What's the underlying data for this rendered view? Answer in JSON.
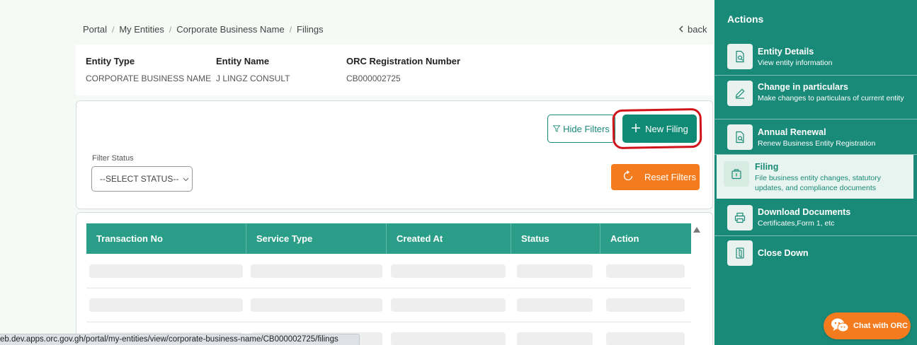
{
  "breadcrumb": [
    "Portal",
    "My Entities",
    "Corporate Business Name",
    "Filings"
  ],
  "breadcrumb_sep": "/",
  "back_label": "back",
  "entity": {
    "type_label": "Entity Type",
    "type_value": "CORPORATE BUSINESS NAME",
    "name_label": "Entity Name",
    "name_value": "J LINGZ CONSULT",
    "reg_label": "ORC Registration Number",
    "reg_value": "CB000002725"
  },
  "filters": {
    "hide_label": "Hide Filters",
    "new_label": "New Filing",
    "status_label": "Filter Status",
    "status_placeholder": "--SELECT STATUS--",
    "reset_label": "Reset Filters"
  },
  "table": {
    "columns": [
      "Transaction No",
      "Service Type",
      "Created At",
      "Status",
      "Action"
    ],
    "loading_rows": 3
  },
  "status_url": "eb.dev.apps.orc.gov.gh/portal/my-entities/view/corporate-business-name/CB000002725/filings",
  "sidebar": {
    "title": "Actions",
    "items": [
      {
        "label": "Entity Details",
        "desc": "View entity information",
        "icon": "file-search-icon"
      },
      {
        "label": "Change in particulars",
        "desc": "Make changes to particulars of current entity",
        "icon": "pencil-icon"
      },
      {
        "label": "Annual Renewal",
        "desc": "Renew Business Entity Registration",
        "icon": "file-search-icon"
      },
      {
        "label": "Filing",
        "desc": "File business entity changes, statutory updates, and compliance documents",
        "icon": "folder-icon",
        "active": true
      },
      {
        "label": "Download Documents",
        "desc": "Certificates,Form 1, etc",
        "icon": "printer-icon"
      },
      {
        "label": "Close Down",
        "desc": "",
        "icon": "door-exit-icon"
      }
    ]
  },
  "chat_label": "Chat with ORC",
  "colors": {
    "primary": "#1a8a78",
    "header": "#2a9e89",
    "accent": "#f47c1f",
    "highlight": "#d1141b"
  }
}
